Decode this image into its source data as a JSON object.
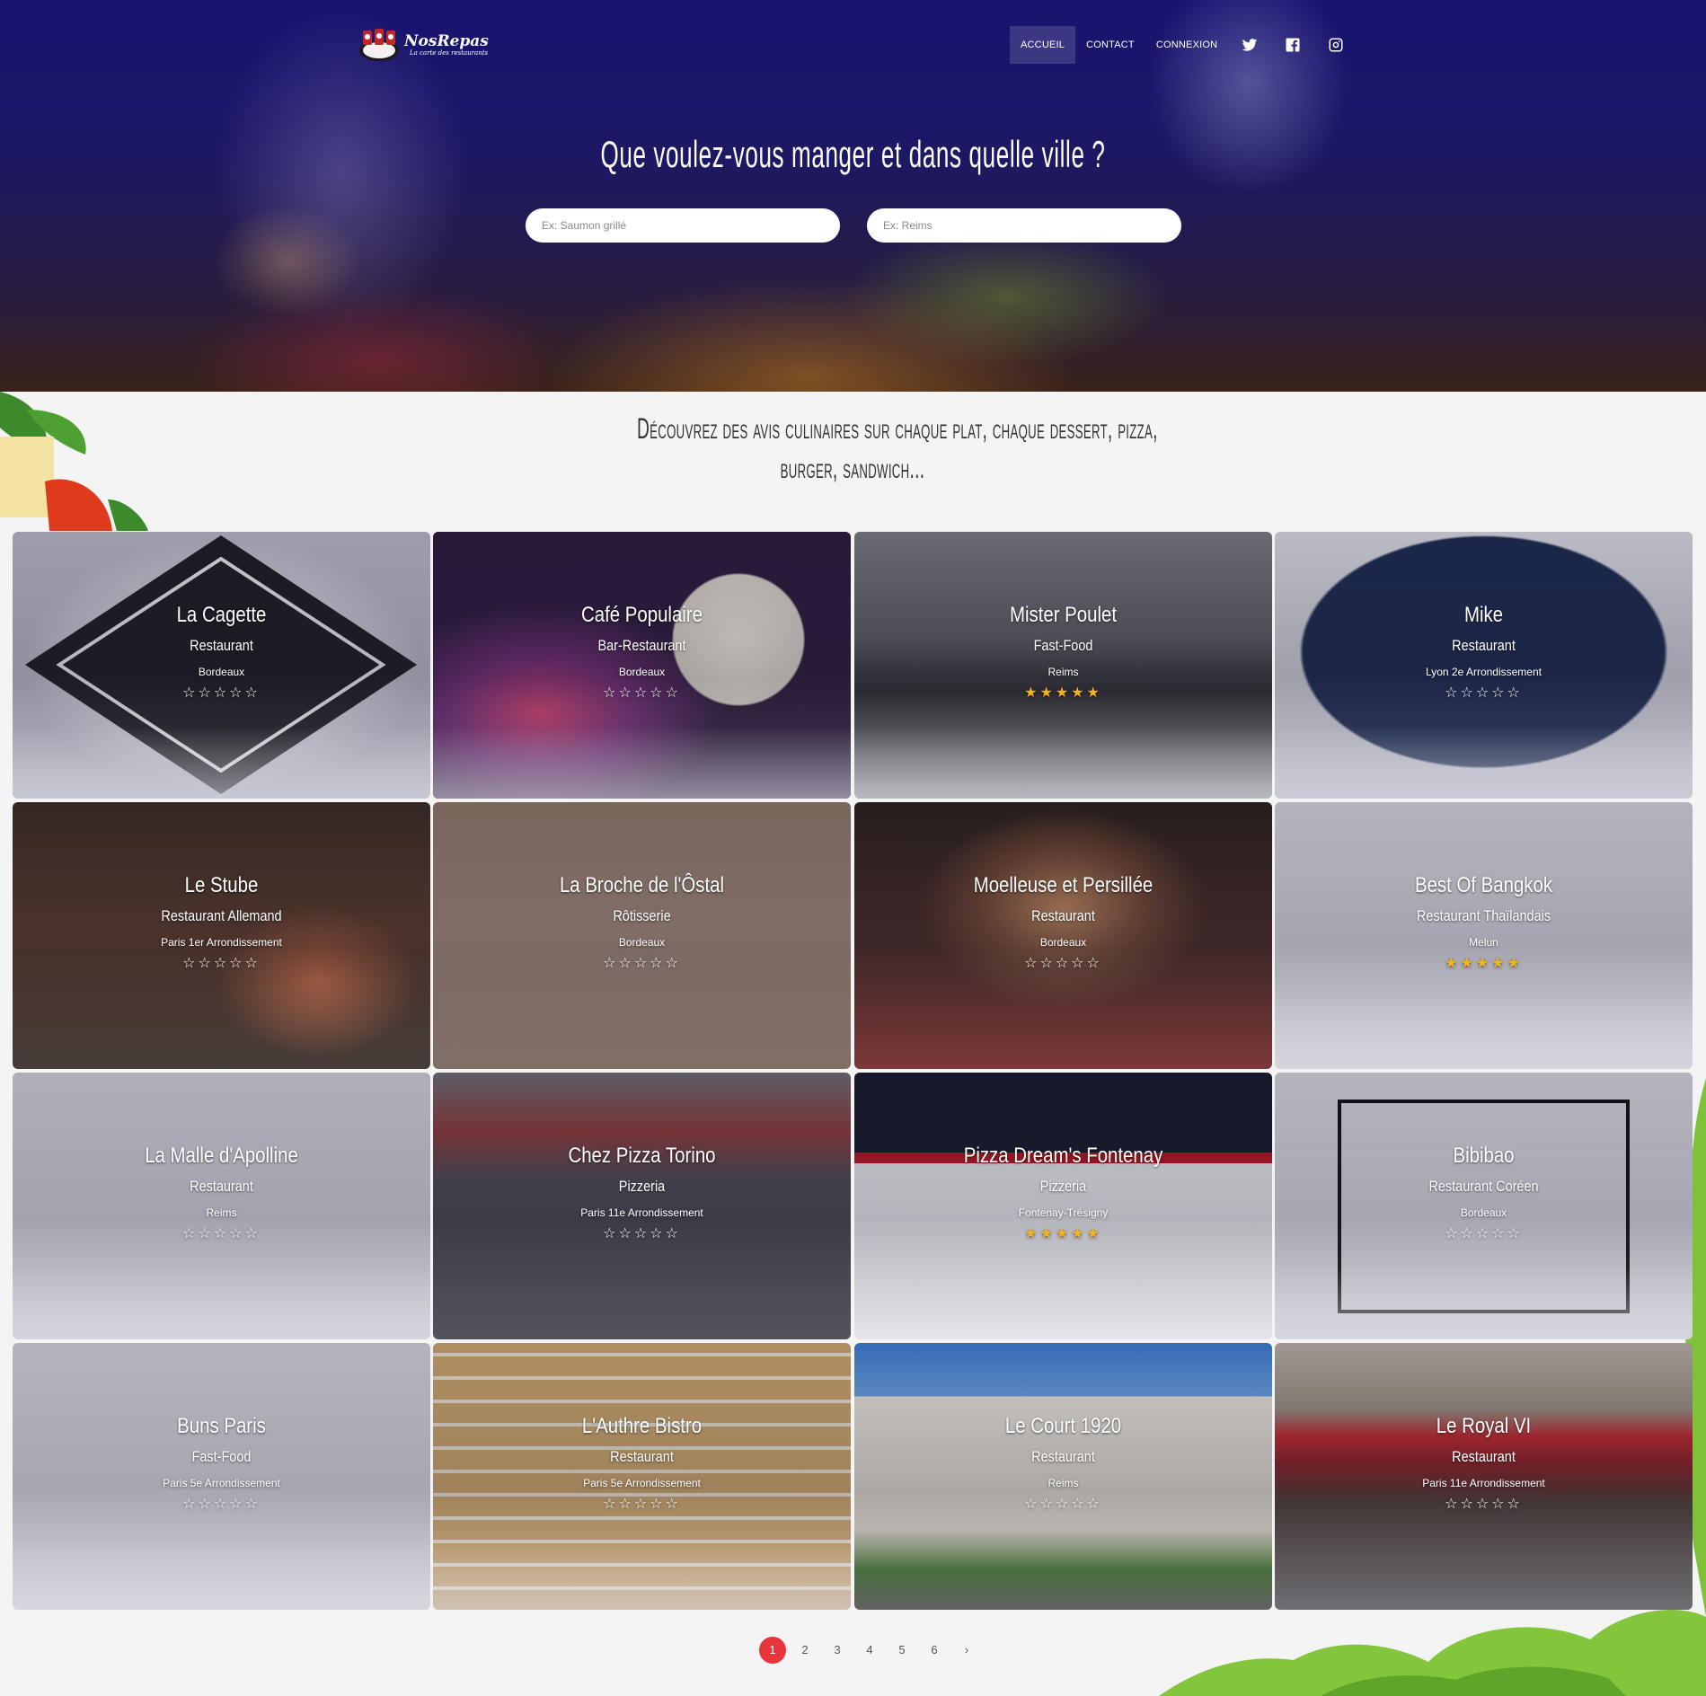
{
  "brand": {
    "name": "NosRepas",
    "tagline": "La carte des restaurants"
  },
  "nav": {
    "links": [
      {
        "label": "ACCUEIL",
        "active": true
      },
      {
        "label": "CONTACT",
        "active": false
      },
      {
        "label": "CONNEXION",
        "active": false
      }
    ],
    "social": [
      "twitter-icon",
      "facebook-icon",
      "instagram-icon"
    ]
  },
  "hero": {
    "title": "Que voulez-vous manger et dans quelle ville ?",
    "dish_placeholder": "Ex: Saumon grillé",
    "city_placeholder": "Ex: Reims"
  },
  "subtitle": {
    "line1": "Découvrez des avis culinaires sur chaque plat, chaque dessert, pizza,",
    "line2": "burger, sandwich..."
  },
  "colors": {
    "accent": "#e8353b",
    "star": "#f6b21b",
    "hero": "#1f1a63"
  },
  "restaurants": [
    {
      "name": "La Cagette",
      "type": "Restaurant",
      "city": "Bordeaux",
      "rating": 0,
      "stars": "☆☆☆☆☆"
    },
    {
      "name": "Café Populaire",
      "type": "Bar-Restaurant",
      "city": "Bordeaux",
      "rating": 0,
      "stars": "☆☆☆☆☆"
    },
    {
      "name": "Mister Poulet",
      "type": "Fast-Food",
      "city": "Reims",
      "rating": 4.5,
      "stars": "★★★★★"
    },
    {
      "name": "Mike",
      "type": "Restaurant",
      "city": "Lyon 2e Arrondissement",
      "rating": 0,
      "stars": "☆☆☆☆☆"
    },
    {
      "name": "Le Stube",
      "type": "Restaurant Allemand",
      "city": "Paris 1er Arrondissement",
      "rating": 0,
      "stars": "☆☆☆☆☆"
    },
    {
      "name": "La Broche de l'Ôstal",
      "type": "Rôtisserie",
      "city": "Bordeaux",
      "rating": 0,
      "stars": "☆☆☆☆☆"
    },
    {
      "name": "Moelleuse et Persillée",
      "type": "Restaurant",
      "city": "Bordeaux",
      "rating": 0,
      "stars": "☆☆☆☆☆"
    },
    {
      "name": "Best Of Bangkok",
      "type": "Restaurant Thaïlandais",
      "city": "Melun",
      "rating": 5,
      "stars": "★★★★★"
    },
    {
      "name": "La Malle d'Apolline",
      "type": "Restaurant",
      "city": "Reims",
      "rating": 0,
      "stars": "☆☆☆☆☆"
    },
    {
      "name": "Chez Pizza Torino",
      "type": "Pizzeria",
      "city": "Paris 11e Arrondissement",
      "rating": 0,
      "stars": "☆☆☆☆☆"
    },
    {
      "name": "Pizza Dream's Fontenay",
      "type": "Pizzeria",
      "city": "Fontenay-Trésigny",
      "rating": 5,
      "stars": "★★★★★"
    },
    {
      "name": "Bibibao",
      "type": "Restaurant Coréen",
      "city": "Bordeaux",
      "rating": 0,
      "stars": "☆☆☆☆☆"
    },
    {
      "name": "Buns Paris",
      "type": "Fast-Food",
      "city": "Paris 5e Arrondissement",
      "rating": 0,
      "stars": "☆☆☆☆☆"
    },
    {
      "name": "L'Authre Bistro",
      "type": "Restaurant",
      "city": "Paris 5e Arrondissement",
      "rating": 0,
      "stars": "☆☆☆☆☆"
    },
    {
      "name": "Le Court 1920",
      "type": "Restaurant",
      "city": "Reims",
      "rating": 0,
      "stars": "☆☆☆☆☆"
    },
    {
      "name": "Le Royal VI",
      "type": "Restaurant",
      "city": "Paris 11e Arrondissement",
      "rating": 0,
      "stars": "☆☆☆☆☆"
    }
  ],
  "pagination": {
    "pages": [
      "1",
      "2",
      "3",
      "4",
      "5",
      "6"
    ],
    "current": "1",
    "next": "›"
  }
}
